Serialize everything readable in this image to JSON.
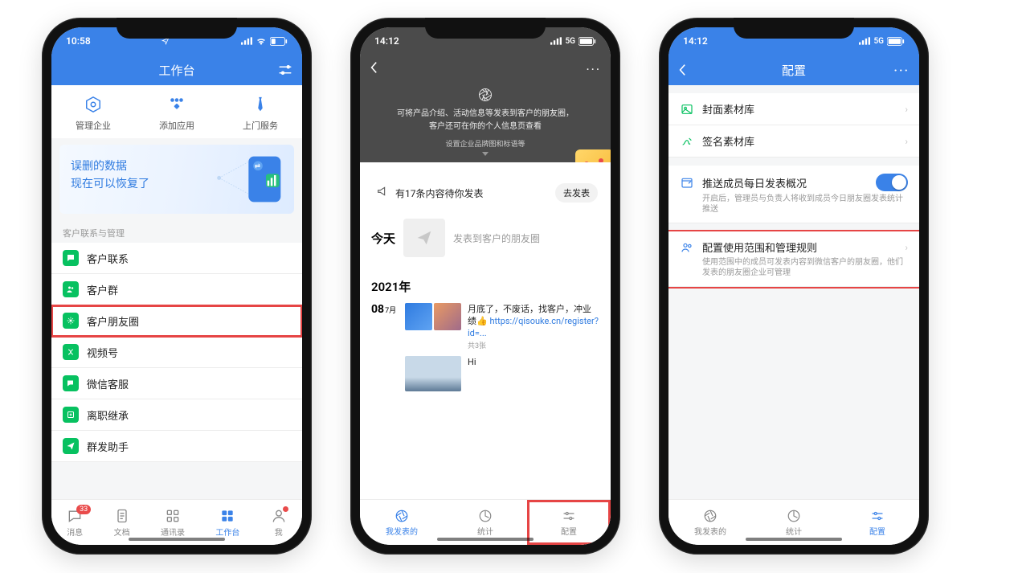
{
  "phone1": {
    "status": {
      "time": "10:58",
      "wifi": true,
      "battery": "low"
    },
    "title": "工作台",
    "quick": [
      {
        "label": "管理企业",
        "icon": "gear"
      },
      {
        "label": "添加应用",
        "icon": "apps"
      },
      {
        "label": "上门服务",
        "icon": "tie"
      }
    ],
    "promo": {
      "line1": "误删的数据",
      "line2": "现在可以恢复了"
    },
    "section_label": "客户联系与管理",
    "list": [
      {
        "label": "客户联系",
        "icon": "chat",
        "color": "#07C160"
      },
      {
        "label": "客户群",
        "icon": "group",
        "color": "#07C160"
      },
      {
        "label": "客户朋友圈",
        "icon": "moments",
        "color": "#07C160",
        "highlight": true
      },
      {
        "label": "视频号",
        "icon": "video",
        "color": "#07C160"
      },
      {
        "label": "微信客服",
        "icon": "service",
        "color": "#07C160"
      },
      {
        "label": "离职继承",
        "icon": "inherit",
        "color": "#07C160"
      },
      {
        "label": "群发助手",
        "icon": "send",
        "color": "#07C160"
      }
    ],
    "tabs": [
      {
        "label": "消息",
        "badge": "33"
      },
      {
        "label": "文档"
      },
      {
        "label": "通讯录"
      },
      {
        "label": "工作台",
        "active": true
      },
      {
        "label": "我",
        "dot": true
      }
    ]
  },
  "phone2": {
    "status": {
      "time": "14:12",
      "network": "5G"
    },
    "intro_line1": "可将产品介绍、活动信息等发表到客户的朋友圈，",
    "intro_line2": "客户还可在你的个人信息页查看",
    "intro_sub": "设置企业品牌图和标语等",
    "notice": {
      "text": "有17条内容待你发表",
      "button": "去发表"
    },
    "today_label": "今天",
    "today_hint": "发表到客户的朋友圈",
    "year_label": "2021年",
    "entry1": {
      "day": "08",
      "month": "7月",
      "text_prefix": "月底了，不废话，找客户，冲业绩👍 ",
      "link": "https://qisouke.cn/register?id=...",
      "meta": "共3张",
      "text2": "Hi"
    },
    "tabs": [
      {
        "label": "我发表的",
        "active": true
      },
      {
        "label": "统计"
      },
      {
        "label": "配置",
        "highlight": true
      }
    ]
  },
  "phone3": {
    "status": {
      "time": "14:12",
      "network": "5G"
    },
    "title": "配置",
    "cells": [
      {
        "icon": "cover",
        "icon_color": "#07C160",
        "label": "封面素材库",
        "arrow": true
      },
      {
        "icon": "sign",
        "icon_color": "#07C160",
        "label": "签名素材库",
        "arrow": true
      }
    ],
    "push": {
      "icon": "push",
      "icon_color": "#2F7BE0",
      "label": "推送成员每日发表概况",
      "sub": "开启后，管理员与负责人将收到成员今日朋友圈发表统计推送",
      "on": true
    },
    "scope": {
      "icon": "users",
      "icon_color": "#2F7BE0",
      "label": "配置使用范围和管理规则",
      "sub": "使用范围中的成员可发表内容到微信客户的朋友圈，他们发表的朋友圈企业可管理",
      "arrow": true,
      "highlight": true
    },
    "tabs": [
      {
        "label": "我发表的"
      },
      {
        "label": "统计"
      },
      {
        "label": "配置",
        "active": true
      }
    ]
  }
}
